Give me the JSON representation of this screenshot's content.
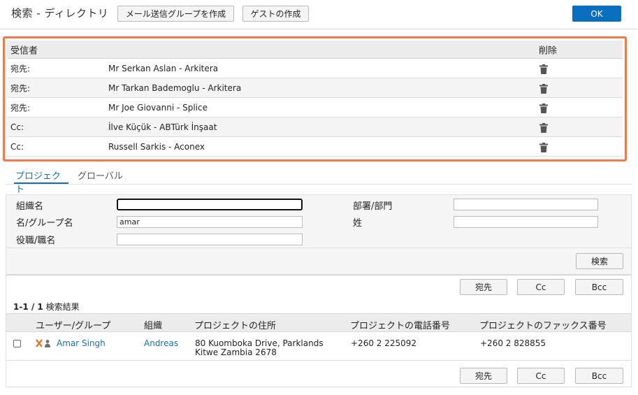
{
  "header": {
    "title": "検索 - ディレクトリ",
    "create_group_label": "メール送信グループを作成",
    "create_guest_label": "ゲストの作成",
    "ok_label": "OK"
  },
  "recipients": {
    "col_recipient": "受信者",
    "col_delete": "削除",
    "rows": [
      {
        "type": "宛先:",
        "name": "Mr Serkan Aslan - Arkitera"
      },
      {
        "type": "宛先:",
        "name": "Mr Tarkan Bademoglu - Arkitera"
      },
      {
        "type": "宛先:",
        "name": "Mr Joe Giovanni - Splice"
      },
      {
        "type": "Cc:",
        "name": "İlve Küçük - ABTürk İnşaat"
      },
      {
        "type": "Cc:",
        "name": "Russell Sarkis - Aconex"
      }
    ]
  },
  "tabs": [
    {
      "label": "プロジェクト",
      "active": true
    },
    {
      "label": "グローバル",
      "active": false
    }
  ],
  "form": {
    "org_label": "組織名",
    "org_value": "",
    "name_label": "名/グループ名",
    "name_value": "amar",
    "title_label": "役職/職名",
    "title_value": "",
    "dept_label": "部署/部門",
    "dept_value": "",
    "surname_label": "姓",
    "surname_value": "",
    "search_label": "検索"
  },
  "results": {
    "to_label": "宛先",
    "cc_label": "Cc",
    "bcc_label": "Bcc",
    "count_range": "1-1 / 1",
    "count_suffix": " 検索結果",
    "columns": [
      "ユーザー/グループ",
      "組織",
      "プロジェクトの住所",
      "プロジェクトの電話番号",
      "プロジェクトのファックス番号"
    ],
    "rows": [
      {
        "name": "Amar Singh",
        "org": "Andreas",
        "address_line1": "80 Kuomboka Drive, Parklands",
        "address_line2": "Kitwe Zambia 2678",
        "phone": "+260 2 225092",
        "fax": "+260 2 828855"
      }
    ]
  },
  "colors": {
    "accent": "#0a6fbf",
    "highlight_border": "#ef7a4c",
    "link": "#1a6fa8"
  }
}
